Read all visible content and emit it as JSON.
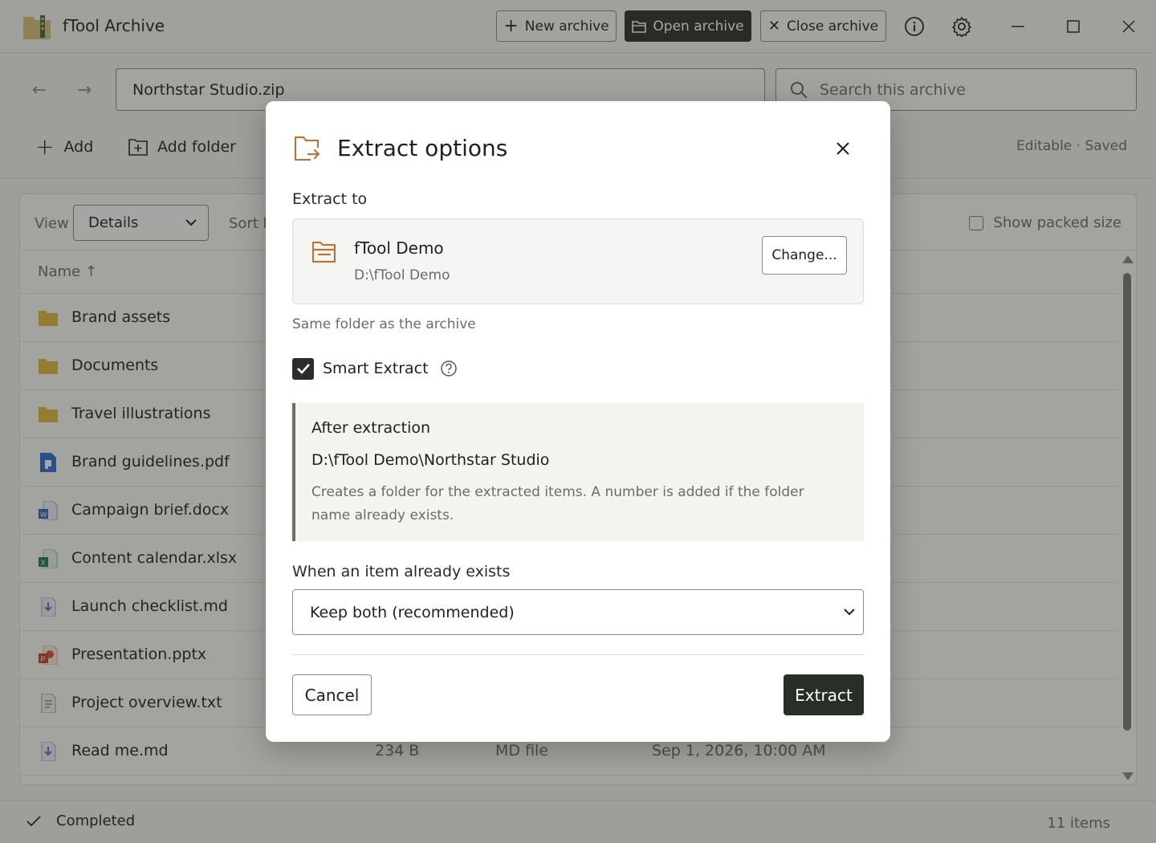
{
  "app": {
    "title": "fTool Archive",
    "buttons": {
      "new_archive": "New archive",
      "open_archive": "Open archive",
      "close_archive": "Close archive"
    }
  },
  "address": {
    "path": "Northstar Studio.zip",
    "search_placeholder": "Search this archive"
  },
  "toolbar": {
    "add": "Add",
    "add_folder": "Add folder",
    "status": "Editable · Saved"
  },
  "list": {
    "view_label": "View",
    "view_value": "Details",
    "sort_label": "Sort b",
    "show_packed": "Show packed size",
    "col_name": "Name ↑",
    "rows": [
      {
        "name": "Brand assets",
        "icon": "folder-icon",
        "size": "",
        "type": "",
        "date": ""
      },
      {
        "name": "Documents",
        "icon": "folder-icon",
        "size": "",
        "type": "",
        "date": ""
      },
      {
        "name": "Travel illustrations",
        "icon": "folder-icon",
        "size": "",
        "type": "",
        "date": ""
      },
      {
        "name": "Brand guidelines.pdf",
        "icon": "pdf-file-icon",
        "size": "",
        "type": "",
        "date": ""
      },
      {
        "name": "Campaign brief.docx",
        "icon": "word-file-icon",
        "size": "",
        "type": "",
        "date": ""
      },
      {
        "name": "Content calendar.xlsx",
        "icon": "excel-file-icon",
        "size": "",
        "type": "",
        "date": ""
      },
      {
        "name": "Launch checklist.md",
        "icon": "markdown-file-icon",
        "size": "",
        "type": "",
        "date": ""
      },
      {
        "name": "Presentation.pptx",
        "icon": "powerpoint-file-icon",
        "size": "",
        "type": "",
        "date": ""
      },
      {
        "name": "Project overview.txt",
        "icon": "text-file-icon",
        "size": "",
        "type": "",
        "date": ""
      },
      {
        "name": "Read me.md",
        "icon": "markdown-file-icon",
        "size": "234 B",
        "type": "MD file",
        "date": "Sep 1, 2026, 10:00 AM"
      }
    ]
  },
  "statusbar": {
    "state": "Completed",
    "count": "11 items"
  },
  "dialog": {
    "title": "Extract options",
    "extract_to_label": "Extract to",
    "dest_name": "fTool Demo",
    "dest_path": "D:\\fTool Demo",
    "change_label": "Change...",
    "hint": "Same folder as the archive",
    "smart_extract_label": "Smart Extract",
    "smart_extract_checked": true,
    "after_title": "After extraction",
    "after_path": "D:\\fTool Demo\\Northstar Studio",
    "after_desc": "Creates a folder for the extracted items. A number is added if the folder name already exists.",
    "exists_label": "When an item already exists",
    "exists_value": "Keep both (recommended)",
    "cancel_label": "Cancel",
    "extract_label": "Extract"
  },
  "colors": {
    "accent_dark": "#2a2e28",
    "folder": "#e2b93b",
    "dialog_folder": "#b07a3c"
  }
}
